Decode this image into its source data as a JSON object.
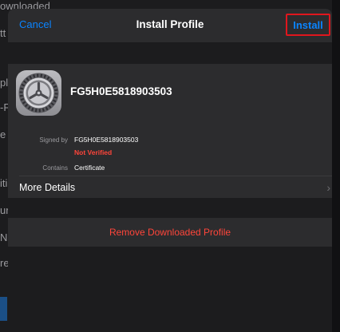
{
  "background": {
    "fragments": [
      "ownloaded",
      "tt",
      "pl",
      "-F",
      "e",
      "iti",
      "ur",
      "N",
      "re"
    ]
  },
  "navbar": {
    "cancel_label": "Cancel",
    "title": "Install Profile",
    "install_label": "Install"
  },
  "profile": {
    "name": "FG5H0E5818903503",
    "icon": "settings-gear-icon",
    "signed_by_label": "Signed by",
    "signed_by_value": "FG5H0E5818903503",
    "verification_status": "Not Verified",
    "contains_label": "Contains",
    "contains_value": "Certificate",
    "more_details_label": "More Details"
  },
  "remove_label": "Remove Downloaded Profile",
  "colors": {
    "accent": "#0a84ff",
    "destructive": "#ff453a",
    "highlight_box": "#e0161d"
  }
}
